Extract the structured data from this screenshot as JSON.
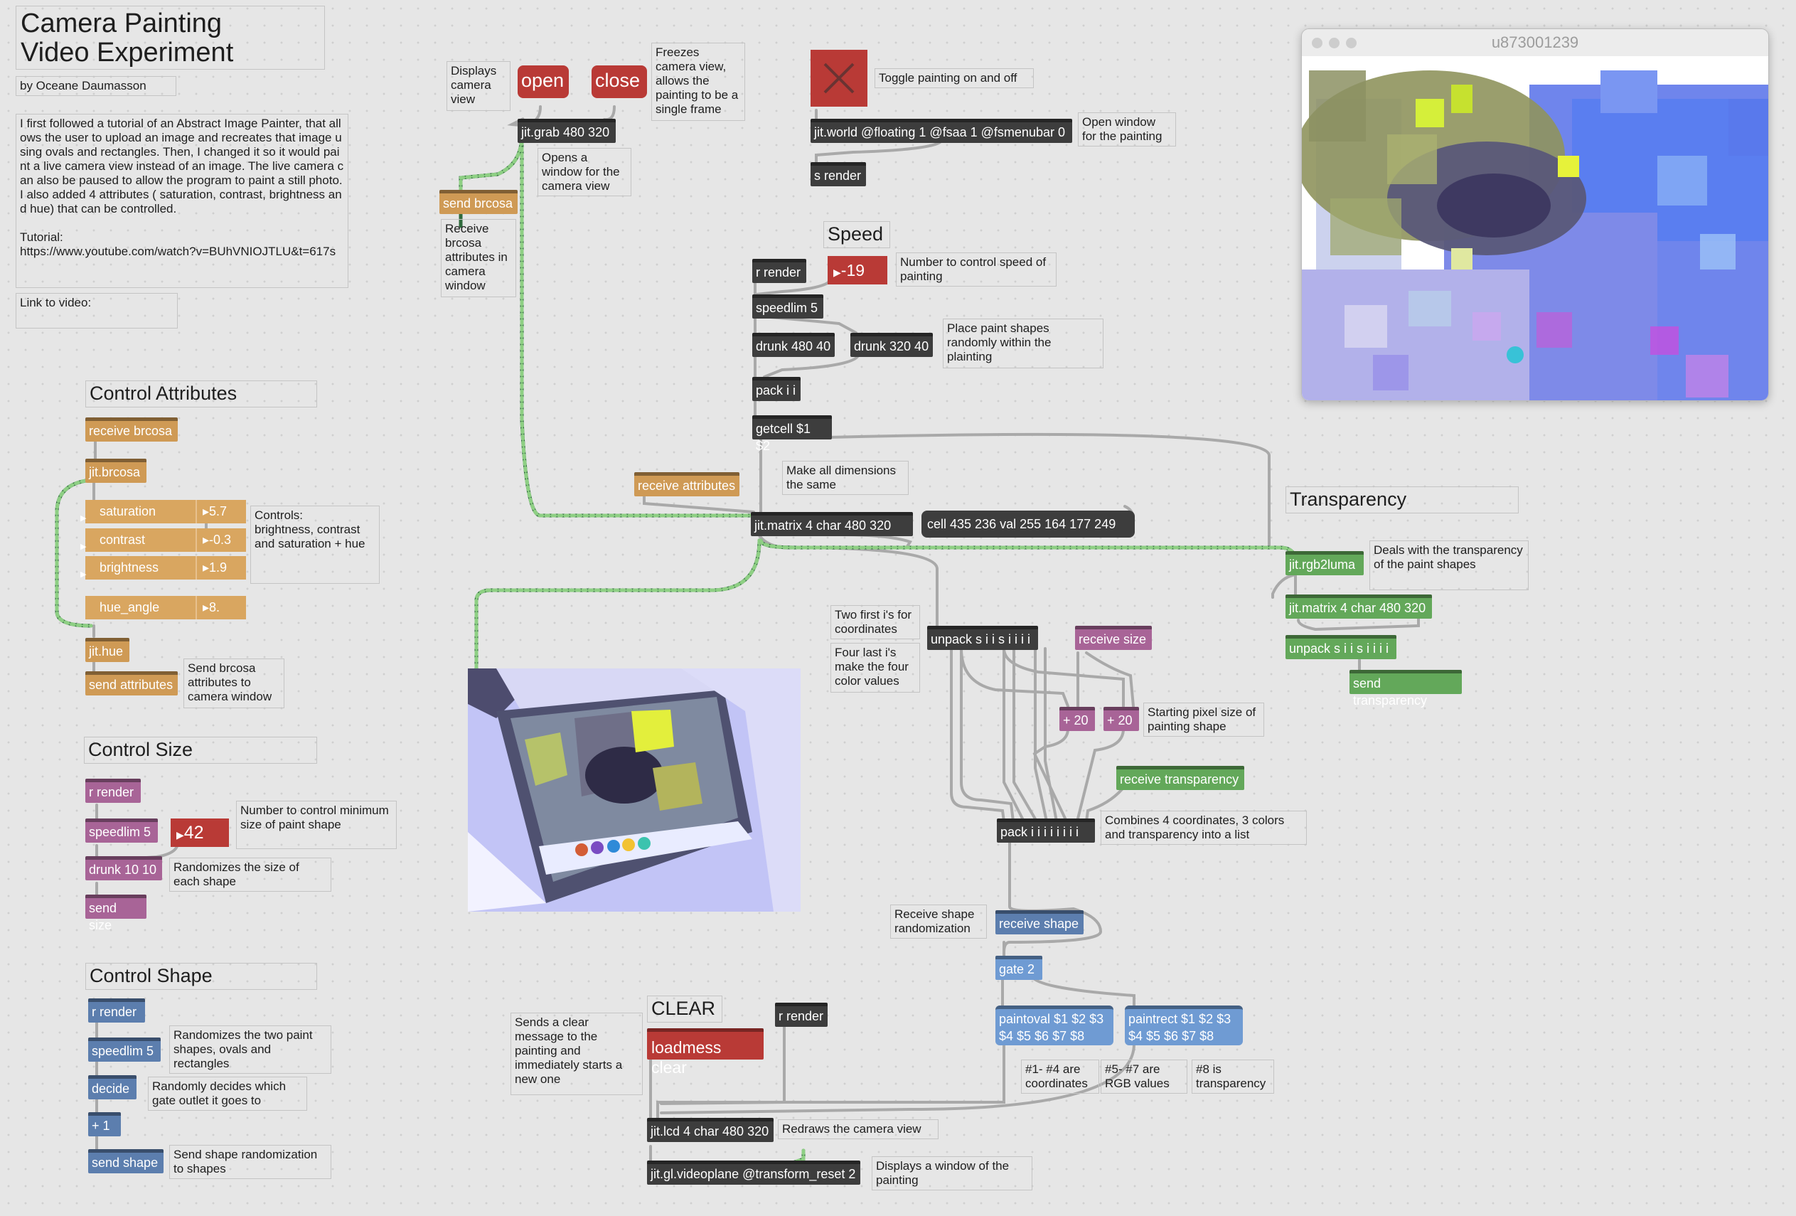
{
  "header": {
    "title": "Camera Painting\nVideo Experiment",
    "author": "by Oceane Daumasson",
    "description": "I first followed a tutorial of an Abstract Image Painter, that allows the user to upload an image and recreates that image using ovals and rectangles. Then, I changed it so it would paint a live camera view instead of an image. The live camera can also be paused to allow the program to paint a still photo. I also added 4 attributes ( saturation, contrast, brightness and hue) that can be controlled.\n\nTutorial:\nhttps://www.youtube.com/watch?v=BUhVNIOJTLU&t=617s",
    "video_link": "Link to video:"
  },
  "attributes": {
    "section_title": "Control Attributes",
    "receive_brcosa": "receive brcosa",
    "jit_brcosa": "jit.brcosa",
    "saturation_label": "saturation",
    "saturation_value": "5.7",
    "contrast_label": "contrast",
    "contrast_value": "-0.3",
    "brightness_label": "brightness",
    "brightness_value": "1.9",
    "hue_label": "hue_angle",
    "hue_value": "8.",
    "controls_comment": "Controls:\nbrightness, contrast and saturation + hue",
    "jit_hue": "jit.hue",
    "send_attributes": "send attributes",
    "send_comment": "Send brcosa attributes to camera window"
  },
  "size": {
    "section_title": "Control Size",
    "r_render": "r render",
    "speedlim": "speedlim 5",
    "number": "42",
    "number_comment": "Number to control minimum size of paint shape",
    "drunk": "drunk 10 10",
    "drunk_comment": "Randomizes the size of each shape",
    "send_size": "send size"
  },
  "shape": {
    "section_title": "Control Shape",
    "r_render": "r render",
    "speedlim": "speedlim 5",
    "speedlim_comment": "Randomizes the two paint shapes, ovals and rectangles",
    "decide": "decide",
    "decide_comment": "Randomly decides which gate outlet it goes to",
    "plus_one": "+ 1",
    "send_shape": "send shape",
    "send_comment": "Send shape randomization to shapes"
  },
  "camera": {
    "displays_comment": "Displays camera view",
    "open_label": "open",
    "close_label": "close",
    "freezes_comment": "Freezes camera view, allows the painting to be a single frame",
    "jit_grab": "jit.grab 480 320",
    "opens_comment": "Opens a window for the camera view",
    "send_brcosa": "send brcosa",
    "receive_comment": "Receive brcosa attributes in camera window"
  },
  "world": {
    "toggle_comment": "Toggle painting on and off",
    "jit_world": "jit.world @floating 1 @fsaa 1 @fsmenubar 0",
    "open_window_comment": "Open window for the painting",
    "s_render": "s render"
  },
  "speed": {
    "section_title": "Speed",
    "r_render": "r render",
    "number": "-19",
    "number_comment": "Number to control speed of painting",
    "speedlim": "speedlim 5",
    "drunk_x": "drunk 480 40",
    "drunk_y": "drunk 320 40",
    "drunk_comment": "Place paint shapes randomly within the plainting",
    "pack": "pack i i",
    "getcell": "getcell $1 $2",
    "make_same_comment": "Make all dimensions the same",
    "receive_attributes": "receive attributes",
    "jit_matrix": "jit.matrix 4 char 480 320",
    "cell_message": "cell 435 236 val 255 164 177 249"
  },
  "unpack": {
    "coords_comment": "Two first i's for coordinates",
    "colors_comment": "Four last i's make the four color values",
    "unpack": "unpack s i i s i i i i",
    "receive_size": "receive size",
    "plus_a": "+ 20",
    "plus_b": "+ 20",
    "starting_comment": "Starting pixel size of painting shape",
    "receive_transparency": "receive transparency",
    "pack": "pack i i i i i i i i",
    "combines_comment": "Combines 4 coordinates, 3 colors and transparency into a list"
  },
  "transparency": {
    "section_title": "Transparency",
    "rgb2luma": "jit.rgb2luma",
    "deals_comment": "Deals with the transparency of the paint shapes",
    "jit_matrix": "jit.matrix 4 char 480 320",
    "unpack": "unpack s i i s i i i i",
    "send_transparency": "send transparency"
  },
  "shapes_out": {
    "receive_comment": "Receive shape randomization",
    "receive_shape": "receive shape",
    "gate": "gate 2",
    "paintoval": "paintoval $1 $2 $3\n$4 $5 $6 $7 $8",
    "paintrect": "paintrect $1 $2 $3\n$4 $5 $6 $7 $8",
    "coords_comment": "#1- #4 are coordinates",
    "rgb_comment": "#5- #7 are RGB values",
    "transp_comment": "#8 is transparency"
  },
  "clear": {
    "section_title": "CLEAR",
    "sends_comment": "Sends a clear message to the painting and immediately starts a new one",
    "loadmess": "loadmess clear",
    "r_render": "r render",
    "jit_lcd": "jit.lcd 4 char 480 320",
    "redraws_comment": "Redraws the camera view",
    "videoplane": "jit.gl.videoplane @transform_reset 2",
    "displays_comment": "Displays a window of the painting"
  },
  "painting_window": {
    "title": "u873001239"
  },
  "colors": {
    "patch_bg": "#e6e6e6",
    "object_dark": "#3d3d3d",
    "message_red": "#b93a36",
    "attr_orange": "#cf9a55",
    "size_pink": "#a86497",
    "shape_blue": "#5c7eae",
    "transp_green": "#63a85a"
  }
}
